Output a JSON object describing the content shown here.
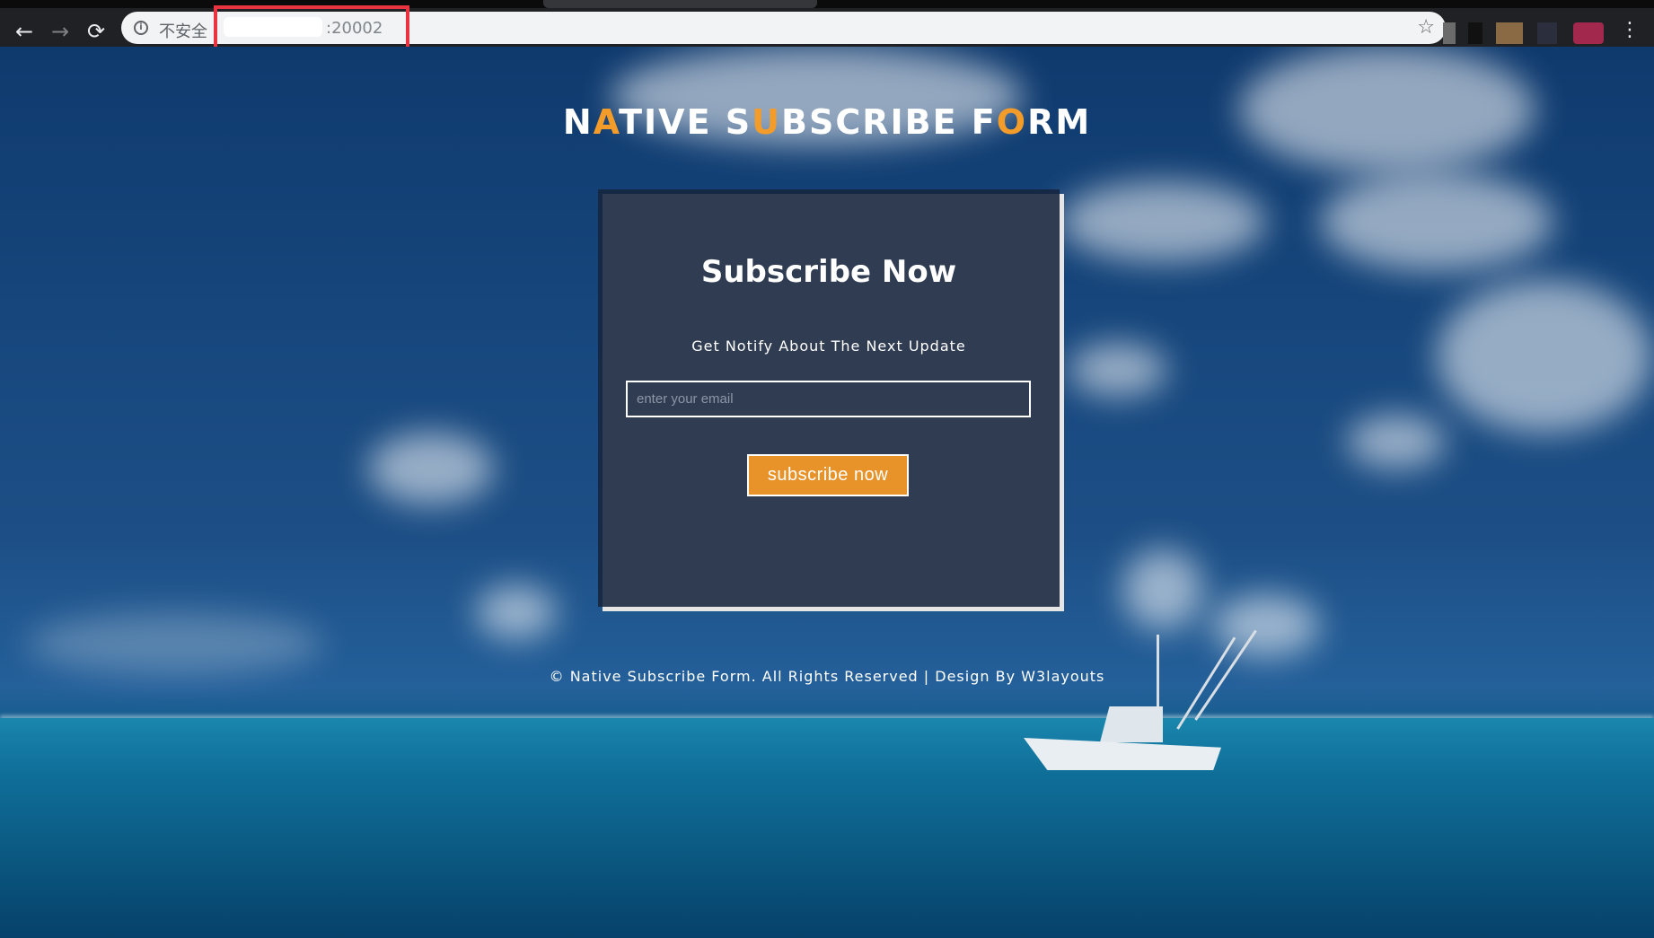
{
  "browser": {
    "security_label": "不安全",
    "url": ":20002",
    "nav": {
      "back": "←",
      "forward": "→",
      "reload": "⟳"
    },
    "icons": {
      "info": "i",
      "star": "☆",
      "menu": "⋮"
    },
    "highlight_color": "#ea3340"
  },
  "site": {
    "title_segments": [
      {
        "text": "N",
        "accent": false
      },
      {
        "text": "A",
        "accent": true
      },
      {
        "text": "TIVE S",
        "accent": false
      },
      {
        "text": "U",
        "accent": true
      },
      {
        "text": "BSCRIBE F",
        "accent": false
      },
      {
        "text": "O",
        "accent": true
      },
      {
        "text": "RM",
        "accent": false
      }
    ],
    "accent_color": "#f39c2a"
  },
  "form": {
    "heading": "Subscribe Now",
    "subtitle": "Get Notify About The Next Update",
    "email_placeholder": "enter your email",
    "email_value": "",
    "button_label": "subscribe now",
    "button_color": "#e8922a"
  },
  "footer": {
    "text": "© Native Subscribe Form. All Rights Reserved | Design By W3layouts"
  }
}
